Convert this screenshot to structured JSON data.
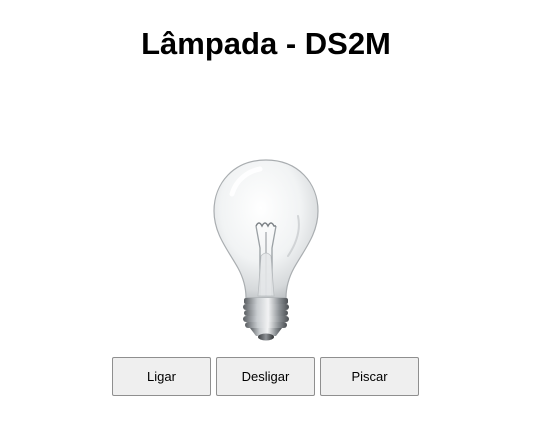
{
  "page": {
    "title": "Lâmpada - DS2M"
  },
  "bulb": {
    "icon": "light-bulb-icon",
    "state": "off"
  },
  "controls": {
    "on_label": "Ligar",
    "off_label": "Desligar",
    "blink_label": "Piscar"
  }
}
